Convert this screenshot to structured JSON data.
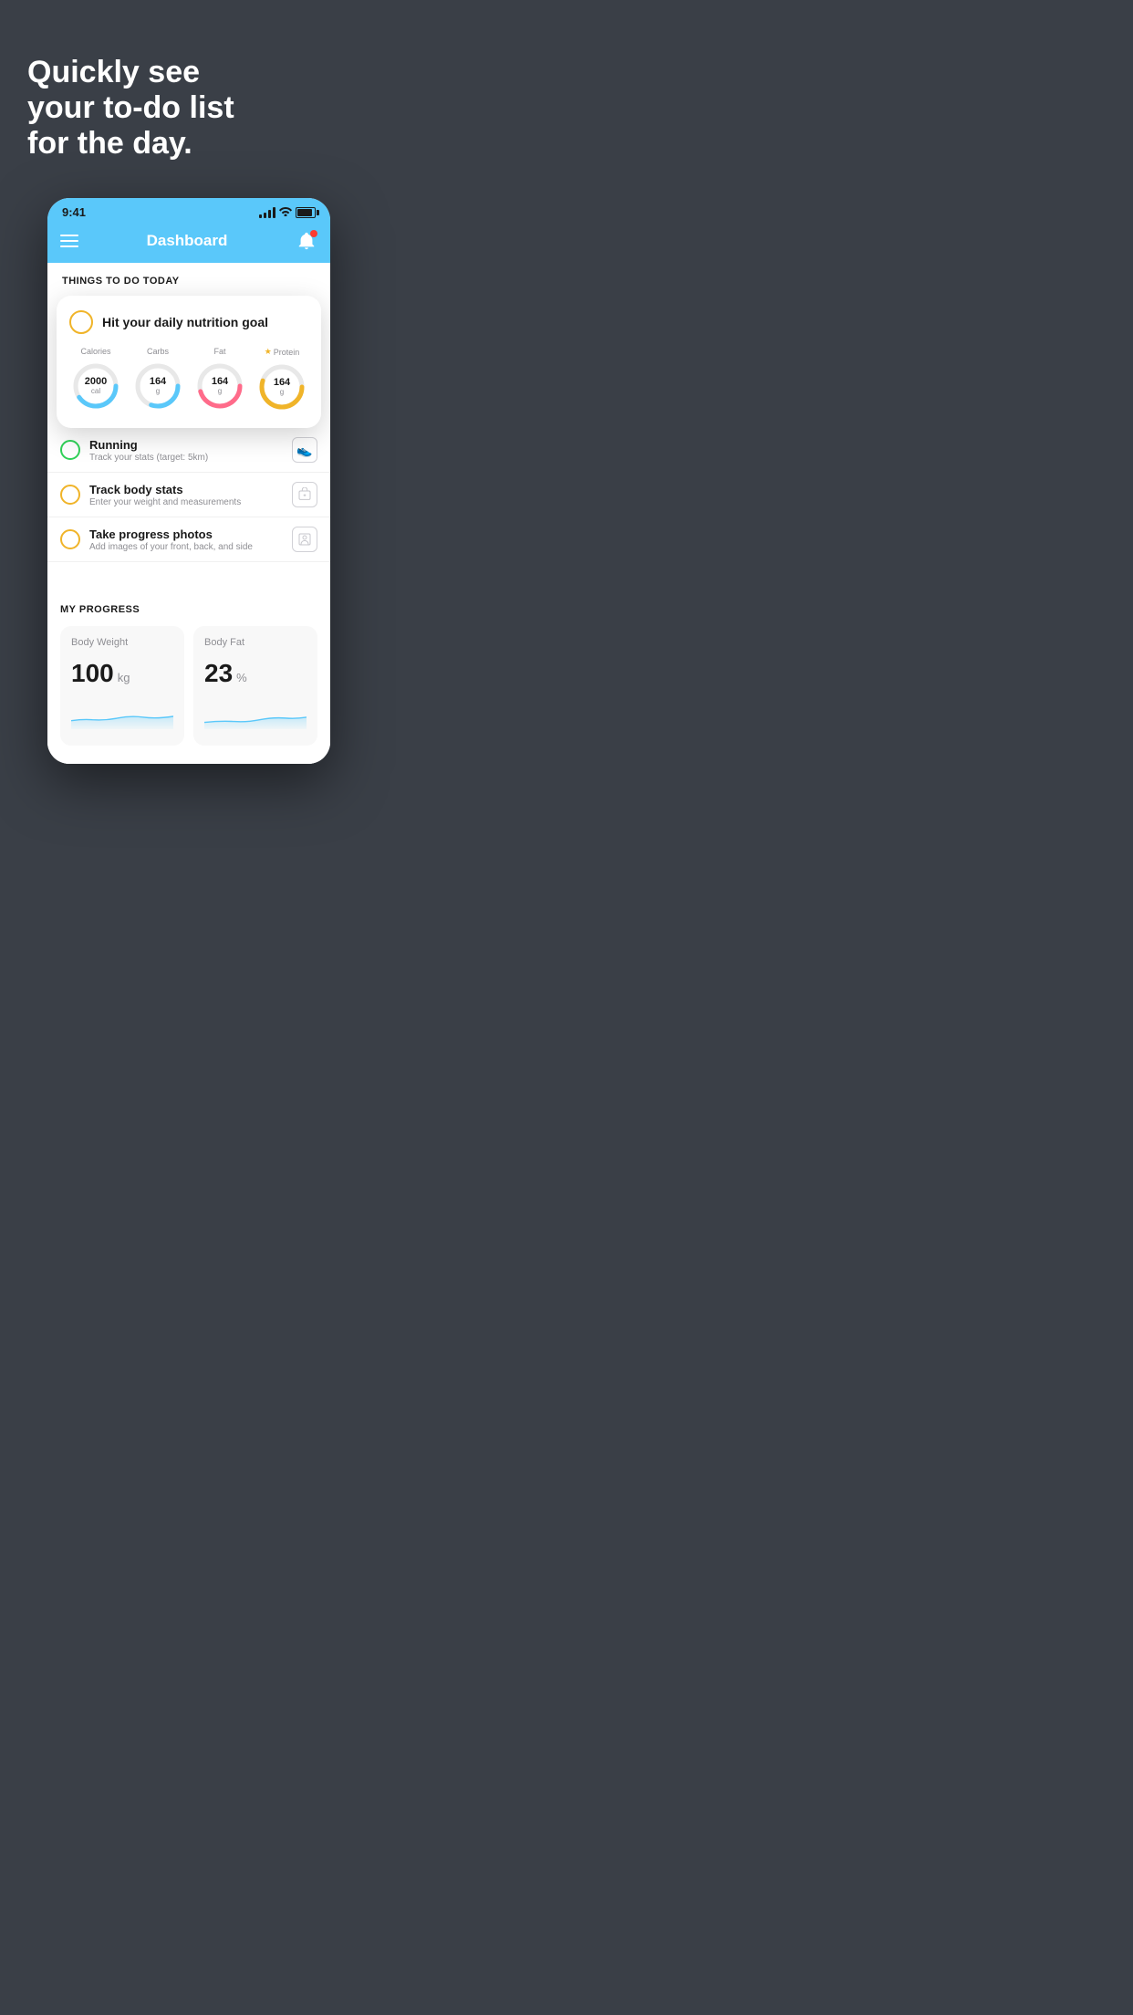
{
  "background": {
    "tagline_line1": "Quickly see",
    "tagline_line2": "your to-do list",
    "tagline_line3": "for the day."
  },
  "phone": {
    "status": {
      "time": "9:41"
    },
    "navbar": {
      "title": "Dashboard"
    },
    "todo_header": "THINGS TO DO TODAY",
    "floating_card": {
      "circle_type": "yellow",
      "title": "Hit your daily nutrition goal",
      "nutrition": [
        {
          "label": "Calories",
          "value": "2000",
          "unit": "cal",
          "color": "#5ac8fa",
          "percent": 65
        },
        {
          "label": "Carbs",
          "value": "164",
          "unit": "g",
          "color": "#5ac8fa",
          "percent": 55
        },
        {
          "label": "Fat",
          "value": "164",
          "unit": "g",
          "color": "#ff6b8a",
          "percent": 70
        },
        {
          "label": "Protein",
          "value": "164",
          "unit": "g",
          "color": "#f0b429",
          "percent": 80,
          "star": true
        }
      ]
    },
    "todo_items": [
      {
        "type": "green",
        "title": "Running",
        "subtitle": "Track your stats (target: 5km)",
        "icon": "shoe"
      },
      {
        "type": "yellow",
        "title": "Track body stats",
        "subtitle": "Enter your weight and measurements",
        "icon": "scale"
      },
      {
        "type": "yellow",
        "title": "Take progress photos",
        "subtitle": "Add images of your front, back, and side",
        "icon": "person"
      }
    ],
    "progress": {
      "section_title": "MY PROGRESS",
      "cards": [
        {
          "title": "Body Weight",
          "value": "100",
          "unit": "kg"
        },
        {
          "title": "Body Fat",
          "value": "23",
          "unit": "%"
        }
      ]
    }
  }
}
